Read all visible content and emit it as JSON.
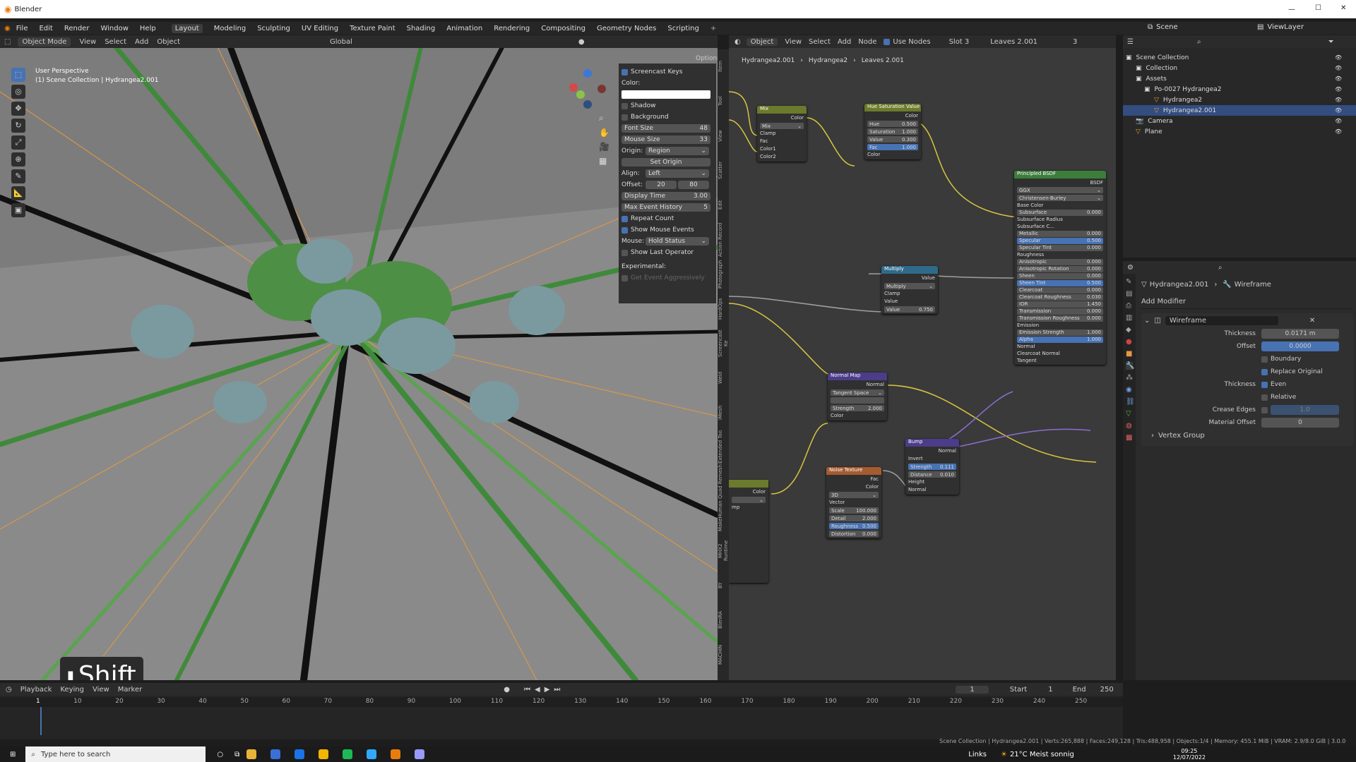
{
  "window": {
    "app_title": "Blender"
  },
  "menu": {
    "file": "File",
    "edit": "Edit",
    "render": "Render",
    "window": "Window",
    "help": "Help"
  },
  "workspaces": [
    "Layout",
    "Modeling",
    "Sculpting",
    "UV Editing",
    "Texture Paint",
    "Shading",
    "Animation",
    "Rendering",
    "Compositing",
    "Geometry Nodes",
    "Scripting"
  ],
  "viewport": {
    "mode": "Object Mode",
    "menus": [
      "View",
      "Select",
      "Add",
      "Object"
    ],
    "transform": "Global",
    "options": "Options",
    "view_name": "User Perspective",
    "collection": "(1) Scene Collection | Hydrangea2.001",
    "key_overlay": "Shift"
  },
  "screencast": {
    "title": "Screencast Keys",
    "color_label": "Color:",
    "shadow": "Shadow",
    "background": "Background",
    "font_size_label": "Font Size",
    "font_size": "48",
    "mouse_size_label": "Mouse Size",
    "mouse_size": "33",
    "origin_label": "Origin:",
    "origin": "Region",
    "set_origin": "Set Origin",
    "align_label": "Align:",
    "align": "Left",
    "offset_label": "Offset:",
    "offset_x": "20",
    "offset_y": "80",
    "display_time_label": "Display Time",
    "display_time": "3.00",
    "max_event_label": "Max Event History",
    "max_event": "5",
    "repeat_count": "Repeat Count",
    "show_mouse": "Show Mouse Events",
    "mouse_label": "Mouse:",
    "mouse_value": "Hold Status",
    "show_last": "Show Last Operator",
    "experimental": "Experimental:",
    "get_event": "Get Event Aggressively"
  },
  "vtabs": [
    "Item",
    "Tool",
    "View",
    "Scatter",
    "Edit",
    "Action Record",
    "Photograph",
    "HardOps",
    "Screencast Ke",
    "Weld",
    "iMesh",
    "Extended Too",
    "Quad Remesh",
    "MakeHuman",
    "MHX2 Runtime",
    "BY",
    "BlenRA",
    "MACHIN"
  ],
  "node_editor": {
    "object": "Object",
    "menus": [
      "View",
      "Select",
      "Add",
      "Node"
    ],
    "use_nodes": "Use Nodes",
    "slot": "Slot 3",
    "material": "Leaves 2.001",
    "users": "3",
    "breadcrumb": [
      "Hydrangea2.001",
      "Hydrangea2",
      "Leaves 2.001"
    ]
  },
  "nodes": {
    "mix": {
      "title": "Mix",
      "out": "Color",
      "mode": "Mix",
      "clamp": "Clamp",
      "fac": "Fac",
      "c1": "Color1",
      "c2": "Color2"
    },
    "hsv": {
      "title": "Hue Saturation Value",
      "out": "Color",
      "hue": "Hue",
      "hue_v": "0.500",
      "sat": "Saturation",
      "sat_v": "1.000",
      "val": "Value",
      "val_v": "0.300",
      "fac": "Fac",
      "fac_v": "1.000",
      "color": "Color"
    },
    "bsdf": {
      "title": "Principled BSDF",
      "out": "BSDF",
      "dist": "GGX",
      "sss": "Christensen-Burley",
      "rows": [
        [
          "Base Color",
          ""
        ],
        [
          "Subsurface",
          "0.000"
        ],
        [
          "Subsurface Radius",
          ""
        ],
        [
          "Subsurface C...",
          ""
        ],
        [
          "Metallic",
          "0.000"
        ],
        [
          "Specular",
          "0.500"
        ],
        [
          "Specular Tint",
          "0.000"
        ],
        [
          "Roughness",
          ""
        ],
        [
          "Anisotropic",
          "0.000"
        ],
        [
          "Anisotropic Rotation",
          "0.000"
        ],
        [
          "Sheen",
          "0.000"
        ],
        [
          "Sheen Tint",
          "0.500"
        ],
        [
          "Clearcoat",
          "0.000"
        ],
        [
          "Clearcoat Roughness",
          "0.030"
        ],
        [
          "IOR",
          "1.450"
        ],
        [
          "Transmission",
          "0.000"
        ],
        [
          "Transmission Roughness",
          "0.000"
        ],
        [
          "Emission",
          ""
        ],
        [
          "Emission Strength",
          "1.000"
        ],
        [
          "Alpha",
          "1.000"
        ],
        [
          "Normal",
          ""
        ],
        [
          "Clearcoat Normal",
          ""
        ],
        [
          "Tangent",
          ""
        ]
      ]
    },
    "multiply": {
      "title": "Multiply",
      "out": "Value",
      "op": "Multiply",
      "clamp": "Clamp",
      "value": "Value",
      "value2": "Value",
      "value2_v": "0.750"
    },
    "normalmap": {
      "title": "Normal Map",
      "out": "Normal",
      "space": "Tangent Space",
      "strength": "Strength",
      "strength_v": "2.000",
      "color": "Color"
    },
    "bump": {
      "title": "Bump",
      "out": "Normal",
      "invert": "Invert",
      "strength": "Strength",
      "strength_v": "0.111",
      "distance": "Distance",
      "distance_v": "0.010",
      "height": "Height",
      "normal": "Normal"
    },
    "noise": {
      "title": "Noise Texture",
      "fac": "Fac",
      "color": "Color",
      "dim": "3D",
      "vector": "Vector",
      "scale": "Scale",
      "scale_v": "100.000",
      "detail": "Detail",
      "detail_v": "2.000",
      "rough": "Roughness",
      "rough_v": "0.500",
      "distort": "Distortion",
      "distort_v": "0.000"
    },
    "partial_color": "Color",
    "partial_mp": "mp"
  },
  "outliner": {
    "scene": "Scene",
    "viewlayer": "ViewLayer",
    "items": [
      "Scene Collection",
      "Collection",
      "Assets",
      "Po-0027 Hydrangea2",
      "Hydrangea2",
      "Hydrangea2.001",
      "Camera",
      "Plane"
    ]
  },
  "properties": {
    "object": "Hydrangea2.001",
    "modifier_tab": "Wireframe",
    "add_modifier": "Add Modifier",
    "modifier": "Wireframe",
    "thickness_label": "Thickness",
    "thickness": "0.0171 m",
    "offset_label": "Offset",
    "offset": "0.0000",
    "boundary": "Boundary",
    "replace_original": "Replace Original",
    "thickness2_label": "Thickness",
    "even": "Even",
    "relative": "Relative",
    "crease_label": "Crease Edges",
    "crease": "1.0",
    "material_offset_label": "Material Offset",
    "material_offset": "0",
    "vertex_group": "Vertex Group"
  },
  "timeline": {
    "menus": [
      "Playback",
      "Keying",
      "View",
      "Marker"
    ],
    "current": "1",
    "start_label": "Start",
    "start": "1",
    "end_label": "End",
    "end": "250",
    "ticks": [
      "1",
      "10",
      "20",
      "30",
      "40",
      "50",
      "60",
      "70",
      "80",
      "90",
      "100",
      "110",
      "120",
      "130",
      "140",
      "150",
      "160",
      "170",
      "180",
      "190",
      "200",
      "210",
      "220",
      "230",
      "240",
      "250"
    ]
  },
  "statusbar": {
    "stats": "Scene Collection | Hydrangea2.001 | Verts:265,888 | Faces:249,128 | Tris:488,958 | Objects:1/4 | Memory: 455.1 MiB | VRAM: 2.9/8.0 GiB | 3.0.0"
  },
  "taskbar": {
    "search": "Type here to search",
    "links": "Links",
    "weather": "21°C Meist sonnig",
    "time": "09:25",
    "date": "12/07/2022"
  },
  "colors": {
    "accent": "#4772b3",
    "wire": "#d8c640",
    "orange": "#e39a3f"
  }
}
